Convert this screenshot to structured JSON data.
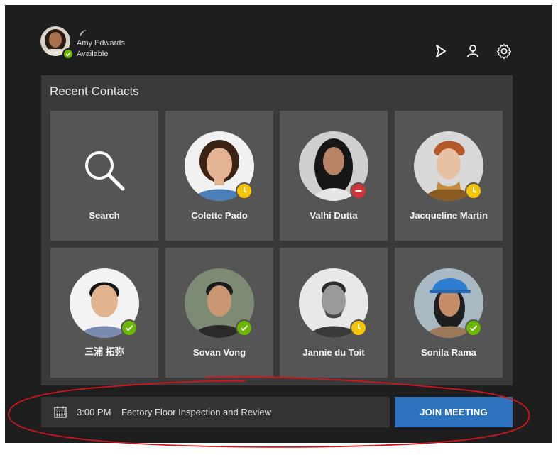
{
  "user": {
    "name": "Amy Edwards",
    "status": "Available",
    "status_color": "#6bb700"
  },
  "header_icons": [
    "share-screen-icon",
    "people-settings-icon",
    "gear-icon"
  ],
  "panel": {
    "title": "Recent Contacts"
  },
  "contacts": [
    {
      "name": "Search",
      "icon": "search-icon"
    },
    {
      "name": "Colette Pado",
      "presence": "away",
      "presence_color": "#f8c300",
      "skin": "#e3b393",
      "hair": "#2b1a10",
      "shirt": "#4a7fb8",
      "bg": "#f1f1f1"
    },
    {
      "name": "Valhi Dutta",
      "presence": "busy",
      "presence_color": "#d13438",
      "skin": "#b98466",
      "hair": "#161616",
      "shirt": "#e6e6e6",
      "bg": "#cfcfcf"
    },
    {
      "name": "Jacqueline Martin",
      "presence": "away",
      "presence_color": "#f8c300",
      "skin": "#e6c0a3",
      "hair": "#b5582b",
      "shirt": "#8a5a20",
      "bg": "#d8d8d8"
    },
    {
      "name": "三浦 拓弥",
      "presence": "available",
      "presence_color": "#6bb700",
      "skin": "#e0b48f",
      "hair": "#141414",
      "shirt": "#7a8ab0",
      "bg": "#f3f3f3"
    },
    {
      "name": "Sovan Vong",
      "presence": "available",
      "presence_color": "#6bb700",
      "skin": "#c99772",
      "hair": "#1a1a1a",
      "shirt": "#2a2a2a",
      "bg": "#7d8a74"
    },
    {
      "name": "Jannie du Toit",
      "presence": "away",
      "presence_color": "#f8c300",
      "skin": "#9a9a9a",
      "hair": "#2a2a2a",
      "shirt": "#3a3a3a",
      "bg": "#e8e8e8"
    },
    {
      "name": "Sonila Rama",
      "presence": "available",
      "presence_color": "#6bb700",
      "skin": "#c48d68",
      "hair": "#1e1e1e",
      "shirt": "#9a7a5a",
      "bg": "#a9b9c4",
      "helmet": "#2e7dd1"
    }
  ],
  "meeting": {
    "time": "3:00 PM",
    "title": "Factory Floor Inspection and Review",
    "icon": "calendar-icon"
  },
  "join_button": {
    "label": "JOIN MEETING",
    "color": "#2d73bd"
  },
  "annotation_color": "#d0161b"
}
